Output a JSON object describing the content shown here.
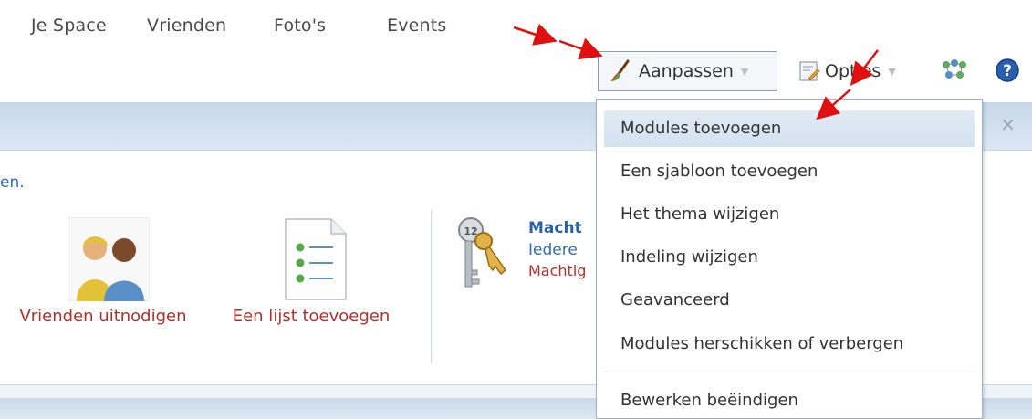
{
  "topnav": {
    "items": [
      {
        "label": "Je Space"
      },
      {
        "label": "Vrienden"
      },
      {
        "label": "Foto's"
      },
      {
        "label": "Events"
      }
    ]
  },
  "toolbar": {
    "customize_label": "Aanpassen",
    "options_label": "Opties",
    "icons": [
      "paintbrush-icon",
      "options-icon",
      "friends-network-icon",
      "help-icon"
    ]
  },
  "panel": {
    "intro_fragment": "en.",
    "actions": [
      {
        "label": "Vrienden uitnodigen",
        "icon": "people-icon"
      },
      {
        "label": "Een lijst toevoegen",
        "icon": "list-icon"
      }
    ],
    "permissions": {
      "title_fragment": "Macht",
      "subtitle_fragment": "Iedere",
      "link_fragment": "Machtig",
      "icon": "keys-icon"
    }
  },
  "menu": {
    "items": [
      {
        "label": "Modules toevoegen",
        "selected": true
      },
      {
        "label": "Een sjabloon toevoegen"
      },
      {
        "label": "Het thema wijzigen"
      },
      {
        "label": "Indeling wijzigen"
      },
      {
        "label": "Geavanceerd"
      },
      {
        "label": "Modules herschikken of verbergen"
      },
      {
        "label": "Bewerken beëindigen"
      }
    ]
  },
  "colors": {
    "accent_link": "#2f6fb3",
    "action_red": "#b0312c",
    "band_blue": "#c7d8ea",
    "annotation_arrow": "#e01010"
  }
}
